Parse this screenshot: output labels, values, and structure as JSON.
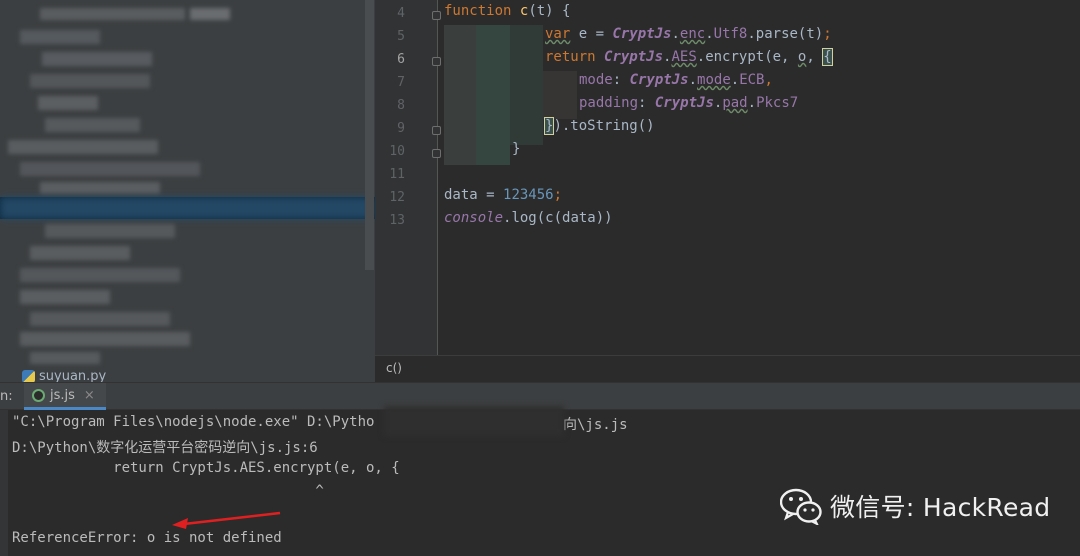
{
  "editor": {
    "lines": [
      {
        "num": "4"
      },
      {
        "num": "5"
      },
      {
        "num": "6"
      },
      {
        "num": "7"
      },
      {
        "num": "8"
      },
      {
        "num": "9"
      },
      {
        "num": "10"
      },
      {
        "num": "11"
      },
      {
        "num": "12"
      },
      {
        "num": "13"
      }
    ],
    "code": {
      "l4_kw": "function",
      "l4_fn": "c",
      "l4_rest": "(t) {",
      "l5_kw": "var",
      "l5_a": " e = ",
      "l5_obj": "CryptJs",
      "l5_b": ".",
      "l5_p1": "enc",
      "l5_c": ".",
      "l5_p2": "Utf8",
      "l5_d": ".parse(t)",
      "l5_semi": ";",
      "l6_kw": "return",
      "l6_sp": " ",
      "l6_obj": "CryptJs",
      "l6_a": ".",
      "l6_p1": "AES",
      "l6_b": ".encrypt(e, ",
      "l6_o": "o",
      "l6_c": ", ",
      "l6_brace": "{",
      "l7_p": "mode",
      "l7_a": ": ",
      "l7_obj": "CryptJs",
      "l7_b": ".",
      "l7_p1": "mode",
      "l7_c": ".",
      "l7_p2": "ECB",
      "l7_comma": ",",
      "l8_p": "padding",
      "l8_a": ": ",
      "l8_obj": "CryptJs",
      "l8_b": ".",
      "l8_p1": "pad",
      "l8_c": ".",
      "l8_p2": "Pkcs7",
      "l9_brace": "}",
      "l9_rest": ").toString()",
      "l10": "}",
      "l12_a": "data = ",
      "l12_num": "123456",
      "l12_semi": ";",
      "l13_obj": "console",
      "l13_a": ".log(c(data))"
    },
    "breadcrumb": "c()"
  },
  "sidebar": {
    "visible_file": "suyuan.py"
  },
  "run": {
    "label": "n:",
    "tab_label": "js.js",
    "tab_close": "×",
    "output": {
      "cmd_a": "\"C:\\Program Files\\nodejs\\node.exe\" D:\\Pytho",
      "cmd_b": "向\\js.js",
      "err_path": "D:\\Python\\数字化运营平台密码逆向\\js.js:6",
      "err_line": "            return CryptJs.AES.encrypt(e, o, {",
      "err_caret": "                                    ^",
      "err_msg": "ReferenceError: o is not defined"
    }
  },
  "watermark": {
    "text": "微信号: HackRead"
  },
  "colors": {
    "keyword": "#cc7832",
    "function": "#ffc66d",
    "object": "#9876aa",
    "number": "#6897bb",
    "arrow": "#e02020"
  }
}
